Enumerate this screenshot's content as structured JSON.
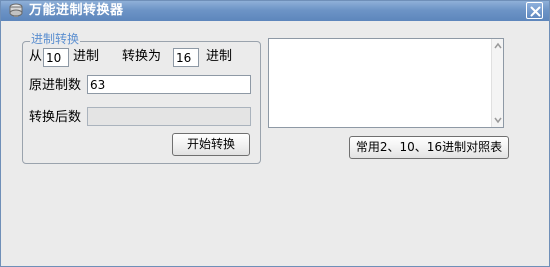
{
  "window": {
    "title": "万能进制转换器"
  },
  "group": {
    "legend": "进制转换",
    "from_label": "从",
    "from_base": "10",
    "from_suffix": "进制",
    "to_label": "转换为",
    "to_base": "16",
    "to_suffix": "进制",
    "source_label": "原进制数",
    "source_value": "63",
    "result_label": "转换后数",
    "result_value": "",
    "convert_button": "开始转换"
  },
  "reference_button": "常用2、10、16进制对照表",
  "output_text": ""
}
